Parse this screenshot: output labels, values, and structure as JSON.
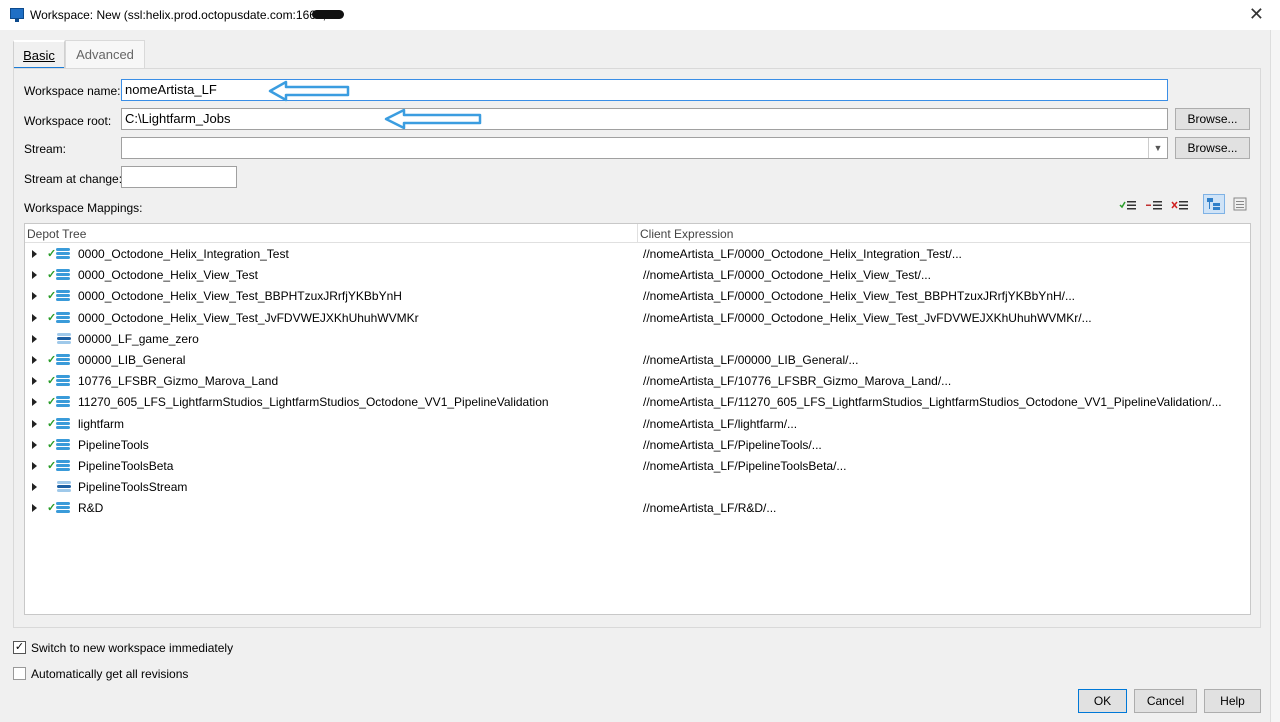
{
  "window": {
    "title": "Workspace: New (ssl:helix.prod.octopusdate.com:1666, ",
    "close_glyph": "✕"
  },
  "tabs": [
    {
      "label": "Basic",
      "active": true
    },
    {
      "label": "Advanced",
      "active": false
    }
  ],
  "form": {
    "workspace_name_label": "Workspace name:",
    "workspace_name_value": "nomeArtista_LF",
    "workspace_root_label": "Workspace root:",
    "workspace_root_value": "C:\\Lightfarm_Jobs",
    "browse_label": "Browse...",
    "stream_label": "Stream:",
    "stream_value": "",
    "stream_at_change_label": "Stream at change:",
    "stream_at_change_value": "",
    "mappings_label": "Workspace Mappings:"
  },
  "grid": {
    "col_depot": "Depot Tree",
    "col_client": "Client Expression",
    "rows": [
      {
        "name": "0000_Octodone_Helix_Integration_Test",
        "expr": "//nomeArtista_LF/0000_Octodone_Helix_Integration_Test/...",
        "type": "depot",
        "mapped": true
      },
      {
        "name": "0000_Octodone_Helix_View_Test",
        "expr": "//nomeArtista_LF/0000_Octodone_Helix_View_Test/...",
        "type": "depot",
        "mapped": true
      },
      {
        "name": "0000_Octodone_Helix_View_Test_BBPHTzuxJRrfjYKBbYnH",
        "expr": "//nomeArtista_LF/0000_Octodone_Helix_View_Test_BBPHTzuxJRrfjYKBbYnH/...",
        "type": "depot",
        "mapped": true
      },
      {
        "name": "0000_Octodone_Helix_View_Test_JvFDVWEJXKhUhuhWVMKr",
        "expr": "//nomeArtista_LF/0000_Octodone_Helix_View_Test_JvFDVWEJXKhUhuhWVMKr/...",
        "type": "depot",
        "mapped": true
      },
      {
        "name": "00000_LF_game_zero",
        "expr": "",
        "type": "stream",
        "mapped": false
      },
      {
        "name": "00000_LIB_General",
        "expr": "//nomeArtista_LF/00000_LIB_General/...",
        "type": "depot",
        "mapped": true
      },
      {
        "name": "10776_LFSBR_Gizmo_Marova_Land",
        "expr": "//nomeArtista_LF/10776_LFSBR_Gizmo_Marova_Land/...",
        "type": "depot",
        "mapped": true
      },
      {
        "name": "11270_605_LFS_LightfarmStudios_LightfarmStudios_Octodone_VV1_PipelineValidation",
        "expr": "//nomeArtista_LF/11270_605_LFS_LightfarmStudios_LightfarmStudios_Octodone_VV1_PipelineValidation/...",
        "type": "depot",
        "mapped": true
      },
      {
        "name": "lightfarm",
        "expr": "//nomeArtista_LF/lightfarm/...",
        "type": "depot",
        "mapped": true
      },
      {
        "name": "PipelineTools",
        "expr": "//nomeArtista_LF/PipelineTools/...",
        "type": "depot",
        "mapped": true
      },
      {
        "name": "PipelineToolsBeta",
        "expr": "//nomeArtista_LF/PipelineToolsBeta/...",
        "type": "depot",
        "mapped": true
      },
      {
        "name": "PipelineToolsStream",
        "expr": "",
        "type": "stream",
        "mapped": false
      },
      {
        "name": "R&D",
        "expr": "//nomeArtista_LF/R&D/...",
        "type": "depot",
        "mapped": true
      }
    ]
  },
  "options": {
    "switch_label": "Switch to new workspace immediately",
    "switch_checked": true,
    "auto_get_label": "Automatically get all revisions",
    "auto_get_checked": false
  },
  "buttons": {
    "ok": "OK",
    "cancel": "Cancel",
    "help": "Help"
  },
  "colors": {
    "accent": "#1a7bd6",
    "annotation_arrow": "#3b9de0",
    "mapped_check": "#2a9d2a"
  }
}
